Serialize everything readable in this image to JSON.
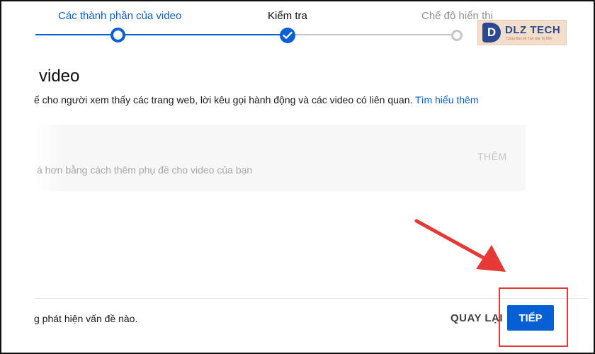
{
  "stepper": {
    "steps": [
      {
        "label": "Các thành phần của video",
        "state": "current"
      },
      {
        "label": "Kiểm tra",
        "state": "completed"
      },
      {
        "label": "Chế độ hiển thị",
        "state": "upcoming"
      }
    ]
  },
  "logo": {
    "mark": "D",
    "text": "DLZ TECH",
    "tagline": "Cùng Bạn Đi Tạo Giá Trị Mới"
  },
  "section": {
    "title": "video",
    "description": "ế cho người xem thấy các trang web, lời kêu gọi hành động và các video có liên quan.",
    "learn_more": "Tìm hiểu thêm"
  },
  "subtitles": {
    "hint": "á hơn bằng cách thêm phụ đề cho video của bạn",
    "add_label": "THÊM"
  },
  "footer": {
    "status": "g phát hiện vấn đề nào.",
    "back_label": "QUAY LẠI",
    "next_label": "TIẾP"
  },
  "colors": {
    "accent": "#065fd4",
    "annotation": "#e53935",
    "muted": "#909090"
  },
  "icons": {
    "completed_step": "check-icon",
    "annotation": "arrow-icon"
  }
}
